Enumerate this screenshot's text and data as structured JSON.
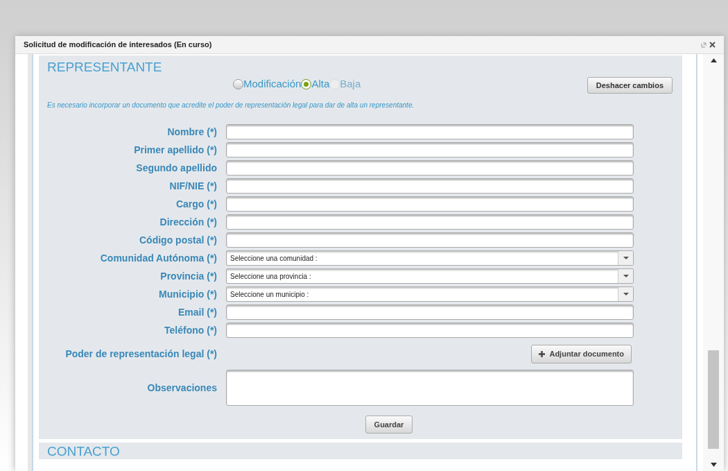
{
  "window": {
    "title": "Solicitud de modificación de interesados (En curso)"
  },
  "section": {
    "title": "REPRESENTANTE",
    "radios": [
      {
        "label": "Modificación",
        "selected": false,
        "disabled": false
      },
      {
        "label": "Alta",
        "selected": true,
        "disabled": false
      },
      {
        "label": "Baja",
        "selected": false,
        "disabled": true
      }
    ],
    "undo_button": "Deshacer cambios",
    "note": "Es necesario incorporar un documento que acredite el poder de representación legal para dar de alta un representante.",
    "fields": [
      {
        "kind": "text",
        "label": "Nombre (*)"
      },
      {
        "kind": "text",
        "label": "Primer apellido (*)"
      },
      {
        "kind": "text",
        "label": "Segundo apellido"
      },
      {
        "kind": "text",
        "label": "NIF/NIE (*)"
      },
      {
        "kind": "text",
        "label": "Cargo (*)"
      },
      {
        "kind": "text",
        "label": "Dirección (*)"
      },
      {
        "kind": "text",
        "label": "Código postal (*)"
      },
      {
        "kind": "select",
        "label": "Comunidad Autónoma (*)",
        "value": "Seleccione una comunidad :"
      },
      {
        "kind": "select",
        "label": "Provincia (*)",
        "value": "Seleccione una provincia :"
      },
      {
        "kind": "select",
        "label": "Municipio (*)",
        "value": "Seleccione un municipio :"
      },
      {
        "kind": "text",
        "label": "Email (*)"
      },
      {
        "kind": "text",
        "label": "Teléfono (*)"
      },
      {
        "kind": "file",
        "label": "Poder de representación legal (*)",
        "button": "Adjuntar documento"
      },
      {
        "kind": "textarea",
        "label": "Observaciones"
      }
    ],
    "save_button": "Guardar"
  },
  "next_section": {
    "title": "CONTACTO"
  }
}
